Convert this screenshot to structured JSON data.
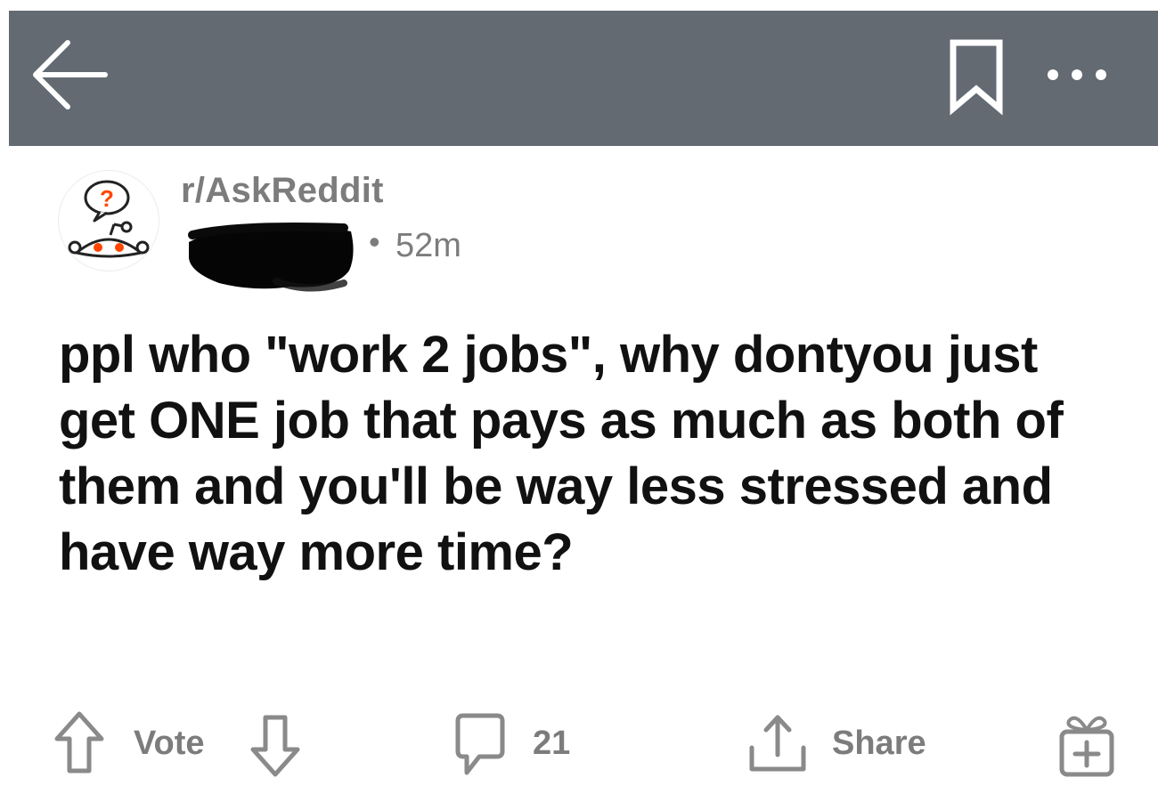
{
  "header": {
    "icons": {
      "back": "back-arrow-icon",
      "save": "bookmark-icon",
      "more": "more-dots-icon"
    },
    "background_color": "#636a72"
  },
  "post": {
    "subreddit": "r/AskReddit",
    "separator": "•",
    "age": "52m",
    "title": "ppl who \"work 2 jobs\", why dontyou just get ONE job that pays as much as both of them and you'll be way less stressed and have way more time?"
  },
  "actions": {
    "vote_label": "Vote",
    "comment_count": "21",
    "share_label": "Share",
    "icons": {
      "upvote": "upvote-arrow-icon",
      "downvote": "downvote-arrow-icon",
      "comment": "comment-bubble-icon",
      "share": "share-upload-icon",
      "award": "gift-award-icon"
    }
  },
  "colors": {
    "header_bg": "#636a72",
    "meta_text": "#7c7c7c",
    "title_text": "#111111",
    "avatar_accent": "#ff4500"
  }
}
